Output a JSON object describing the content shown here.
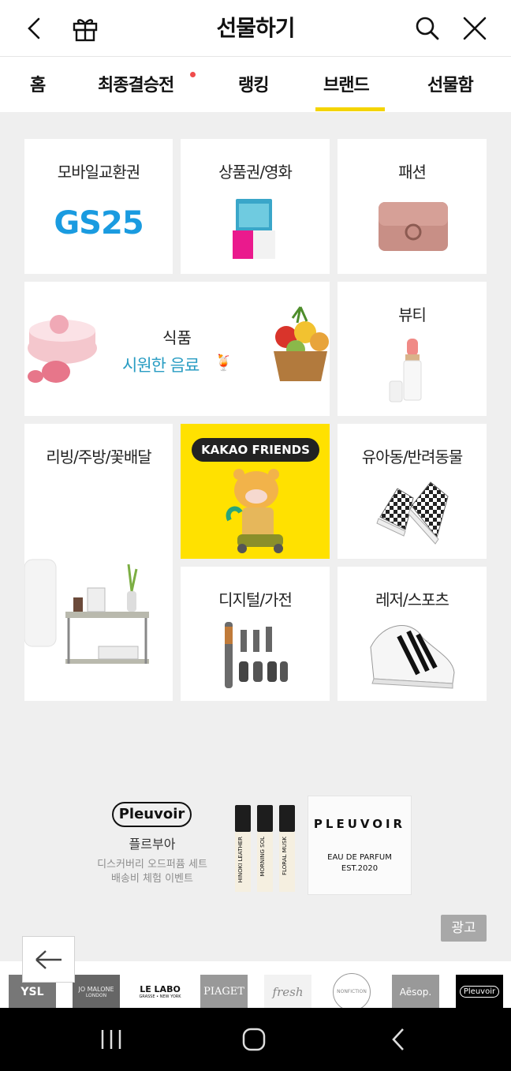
{
  "header": {
    "title": "선물하기"
  },
  "tabs": [
    {
      "label": "홈"
    },
    {
      "label": "최종결승전"
    },
    {
      "label": "랭킹"
    },
    {
      "label": "브랜드"
    },
    {
      "label": "선물함"
    }
  ],
  "categories": {
    "mobile": {
      "label": "모바일교환권",
      "logo": "GS25"
    },
    "voucher": {
      "label": "상품권/영화"
    },
    "fashion": {
      "label": "패션"
    },
    "food": {
      "label": "식품",
      "subtitle": "시원한 음료"
    },
    "beauty": {
      "label": "뷰티"
    },
    "living": {
      "label": "리빙/주방/꽃배달"
    },
    "kakao": {
      "badge": "KAKAO FRIENDS"
    },
    "kids": {
      "label": "유아동/반려동물"
    },
    "digital": {
      "label": "디지털/가전"
    },
    "sports": {
      "label": "레저/스포츠"
    }
  },
  "ad": {
    "brand_logo": "Pleuvoir",
    "brand_name": "플르부아",
    "line1": "디스커버리 오드퍼퓸 세트",
    "line2": "배송비 체험 이벤트",
    "bottle1": "HINOKI LEATHER",
    "bottle2": "MORNING SOL",
    "bottle3": "FLORAL MUSK",
    "box_brand": "PLEUVOIR",
    "box_line1": "EAU DE PARFUM",
    "box_line2": "EST.2020",
    "badge": "광고"
  },
  "brands": [
    "YSL",
    "JO MALONE",
    "LE LABO",
    "PIAGET",
    "fresh",
    "NONFICTION",
    "Aēsop.",
    "Pleuvoir"
  ],
  "brand_sub": {
    "jo_malone": "LONDON",
    "le_labo": "GRASSE • NEW YORK"
  },
  "colors": {
    "accent": "#f4d400",
    "kakao_bg": "#ffe100",
    "link": "#2a9dc3",
    "dot": "#f04b4b"
  }
}
